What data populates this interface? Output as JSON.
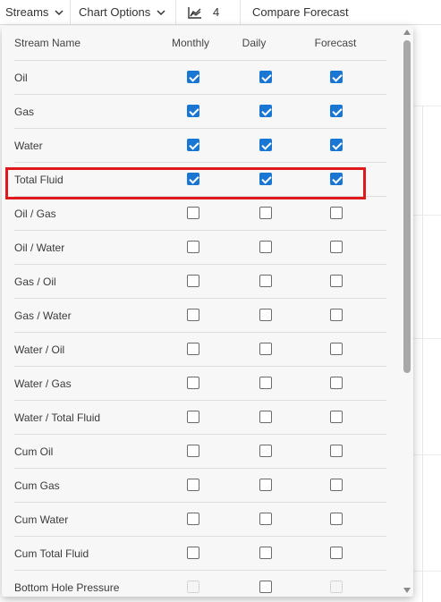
{
  "toolbar": {
    "streams_label": "Streams",
    "chart_options_label": "Chart Options",
    "series_count": "4",
    "compare_forecast_label": "Compare Forecast",
    "streams_icon": "chevron-down-icon",
    "chart_options_icon": "chevron-down-icon",
    "count_icon": "area-chart-icon"
  },
  "panel": {
    "columns": [
      "Stream Name",
      "Monthly",
      "Daily",
      "Forecast"
    ],
    "rows": [
      {
        "name": "Oil",
        "monthly": true,
        "daily": true,
        "forecast": true
      },
      {
        "name": "Gas",
        "monthly": true,
        "daily": true,
        "forecast": true
      },
      {
        "name": "Water",
        "monthly": true,
        "daily": true,
        "forecast": true
      },
      {
        "name": "Total Fluid",
        "monthly": true,
        "daily": true,
        "forecast": true
      },
      {
        "name": "Oil / Gas",
        "monthly": false,
        "daily": false,
        "forecast": false
      },
      {
        "name": "Oil / Water",
        "monthly": false,
        "daily": false,
        "forecast": false
      },
      {
        "name": "Gas / Oil",
        "monthly": false,
        "daily": false,
        "forecast": false
      },
      {
        "name": "Gas / Water",
        "monthly": false,
        "daily": false,
        "forecast": false
      },
      {
        "name": "Water / Oil",
        "monthly": false,
        "daily": false,
        "forecast": false
      },
      {
        "name": "Water / Gas",
        "monthly": false,
        "daily": false,
        "forecast": false
      },
      {
        "name": "Water / Total Fluid",
        "monthly": false,
        "daily": false,
        "forecast": false
      },
      {
        "name": "Cum Oil",
        "monthly": false,
        "daily": false,
        "forecast": false
      },
      {
        "name": "Cum Gas",
        "monthly": false,
        "daily": false,
        "forecast": false
      },
      {
        "name": "Cum Water",
        "monthly": false,
        "daily": false,
        "forecast": false
      },
      {
        "name": "Cum Total Fluid",
        "monthly": false,
        "daily": false,
        "forecast": false
      },
      {
        "name": "Bottom Hole Pressure",
        "monthly": false,
        "daily": false,
        "forecast": false,
        "monthly_disabled": true,
        "forecast_disabled": true
      }
    ]
  },
  "colors": {
    "accent": "#1976d2",
    "highlight": "#e0191c",
    "panel_background": "#f7f7f7"
  }
}
